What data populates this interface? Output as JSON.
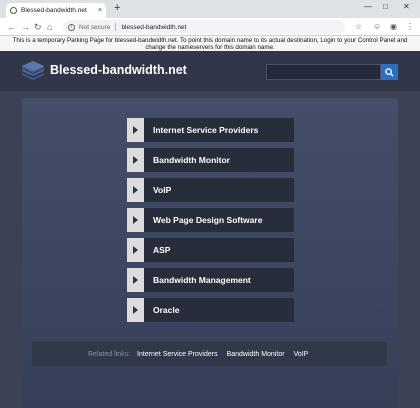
{
  "browser": {
    "tab_title": "Blessed-bandwidth.net",
    "tab_close": "×",
    "new_tab": "+",
    "security_label": "Not secure",
    "url": "blessed-bandwidth.net"
  },
  "notice": {
    "line1": "This is a temporary Parking Page for blessed-bandwidth.net. To point this domain name to its actual destination, Login to your Control Panel and",
    "line2": "change the nameservers for this domain name."
  },
  "site": {
    "name": "Blessed-bandwidth.net",
    "search_placeholder": ""
  },
  "links": [
    {
      "label": "Internet Service Providers"
    },
    {
      "label": "Bandwidth Monitor"
    },
    {
      "label": "VoIP"
    },
    {
      "label": "Web Page Design Software"
    },
    {
      "label": "ASP"
    },
    {
      "label": "Bandwidth Management"
    },
    {
      "label": "Oracle"
    }
  ],
  "related": {
    "label": "Related links:",
    "items": [
      "Internet Service Providers",
      "Bandwidth Monitor",
      "VoIP"
    ]
  },
  "colors": {
    "accent": "#2a6fc0",
    "page_bg": "#3c4256",
    "item_bg": "#272d3b"
  }
}
